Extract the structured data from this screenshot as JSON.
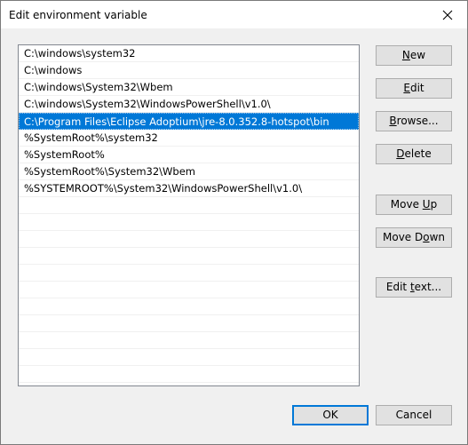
{
  "window": {
    "title": "Edit environment variable",
    "close_icon": "close-icon"
  },
  "path_list": {
    "items": [
      "C:\\windows\\system32",
      "C:\\windows",
      "C:\\windows\\System32\\Wbem",
      "C:\\windows\\System32\\WindowsPowerShell\\v1.0\\",
      "C:\\Program Files\\Eclipse Adoptium\\jre-8.0.352.8-hotspot\\bin",
      "%SystemRoot%\\system32",
      "%SystemRoot%",
      "%SystemRoot%\\System32\\Wbem",
      "%SYSTEMROOT%\\System32\\WindowsPowerShell\\v1.0\\"
    ],
    "selected_index": 4,
    "empty_rows": 11
  },
  "buttons": {
    "new": {
      "mnemonic": "N",
      "rest": "ew"
    },
    "edit": {
      "mnemonic": "E",
      "rest": "dit"
    },
    "browse": {
      "mnemonic": "B",
      "rest": "rowse..."
    },
    "delete": {
      "mnemonic": "D",
      "rest": "elete"
    },
    "move_up": {
      "before": "Move ",
      "mnemonic": "U",
      "rest": "p"
    },
    "move_down": {
      "before": "Move D",
      "mnemonic": "o",
      "rest": "wn"
    },
    "edit_text": {
      "before": "Edit ",
      "mnemonic": "t",
      "rest": "ext..."
    },
    "ok": "OK",
    "cancel": "Cancel"
  },
  "colors": {
    "selection": "#0078d7",
    "button_face": "#e1e1e1",
    "dialog_bg": "#f0f0f0"
  }
}
